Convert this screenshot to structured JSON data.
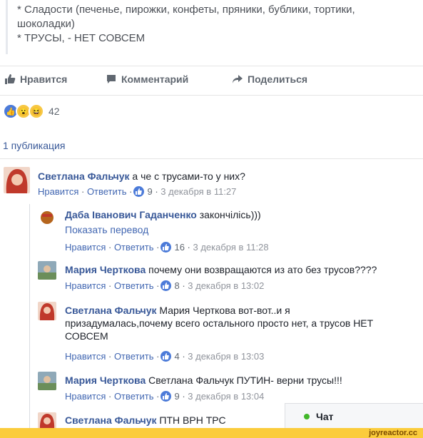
{
  "post": {
    "lines": [
      "* Сладости (печенье, пирожки, конфеты, пряники, бублики, тортики,",
      "шоколадки)",
      "* ТРУСЫ, - НЕТ СОВСЕМ"
    ]
  },
  "actions": {
    "like": "Нравится",
    "comment": "Комментарий",
    "share": "Поделиться"
  },
  "reactions": {
    "count": "42",
    "icons": [
      "like-icon",
      "wow-icon",
      "haha-icon"
    ]
  },
  "publications": "1 публикация",
  "comments": [
    {
      "author": "Светлана Фальчук",
      "text": " а че с трусами-то у них?",
      "like": "Нравится",
      "reply": "Ответить",
      "likes": "9",
      "date": "3 декабря в 11:27"
    },
    {
      "author": "Даба Іванович Гаданченко",
      "text": " закончілісь)))",
      "translate": "Показать перевод",
      "like": "Нравится",
      "reply": "Ответить",
      "likes": "16",
      "date": "3 декабря в 11:28"
    },
    {
      "author": "Мария Черткова",
      "text": " почему они возвращаются из ато без трусов????",
      "like": "Нравится",
      "reply": "Ответить",
      "likes": "8",
      "date": "3 декабря в 13:02"
    },
    {
      "author": "Светлана Фальчук",
      "mention": " Мария Черткова",
      "text_l1": " вот-вот..и я",
      "text_l2": "призадумалась,почему всего остального просто нет, а трусов НЕТ",
      "text_l3": "СОВСЕМ",
      "like": "Нравится",
      "reply": "Ответить",
      "likes": "4",
      "date": "3 декабря в 13:03"
    },
    {
      "author": "Мария Черткова",
      "mention": " Светлана Фальчук",
      "text": " ПУТИН- верни трусы!!!",
      "like": "Нравится",
      "reply": "Ответить",
      "likes": "9",
      "date": "3 декабря в 13:04"
    },
    {
      "author": "Светлана Фальчук",
      "text": " ПТН ВРН ТРС"
    }
  ],
  "chat": {
    "label": "Чат",
    "status_color": "#42b72a"
  },
  "watermark": "joyreactor.cc",
  "colors": {
    "link": "#385898",
    "accent": "#4267b2",
    "like_blue": "#4c7bd9"
  }
}
